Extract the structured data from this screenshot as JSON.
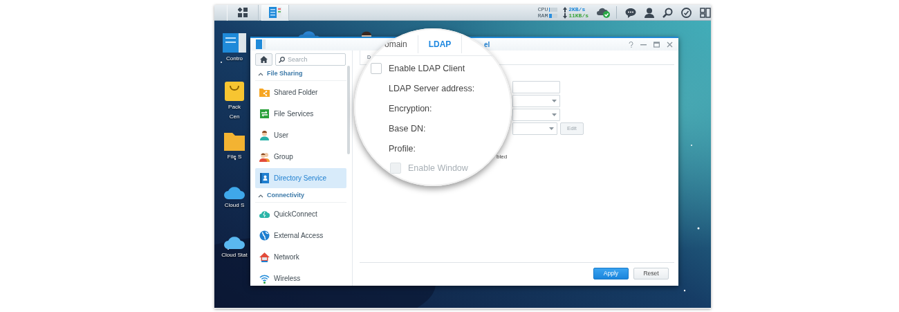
{
  "taskbar": {
    "apps": [
      {
        "kind": "main-menu",
        "selected": false
      },
      {
        "kind": "control-panel",
        "selected": true
      }
    ],
    "meters": [
      {
        "label": "CPU",
        "level": 0.1
      },
      {
        "label": "RAM",
        "level": 0.3
      }
    ],
    "upload": "2KB/s",
    "download": "11KB/s"
  },
  "desktop_icons": [
    {
      "lines": [
        "Contro"
      ]
    },
    {
      "lines": [
        "Pack",
        "Cen"
      ]
    },
    {
      "lines": [
        "File S"
      ]
    },
    {
      "lines": [
        "Cloud S"
      ]
    },
    {
      "lines": [
        "Cloud Stat"
      ]
    }
  ],
  "window": {
    "tab_fragment": "el",
    "sidebar": {
      "search": {
        "placeholder": "Search"
      },
      "sections": [
        {
          "title": "File Sharing",
          "expanded": true,
          "items": [
            {
              "label": "Shared Folder",
              "selected": false
            },
            {
              "label": "File Services",
              "selected": false
            },
            {
              "label": "User",
              "selected": false
            },
            {
              "label": "Group",
              "selected": false
            },
            {
              "label": "Directory Service",
              "selected": true
            }
          ]
        },
        {
          "title": "Connectivity",
          "expanded": true,
          "items": [
            {
              "label": "QuickConnect",
              "selected": false
            },
            {
              "label": "External Access",
              "selected": false
            },
            {
              "label": "Network",
              "selected": false
            },
            {
              "label": "Wireless",
              "selected": false
            }
          ]
        }
      ]
    },
    "pane_hint": "D",
    "fields": [
      {
        "kind": "text"
      },
      {
        "kind": "select"
      },
      {
        "kind": "select"
      },
      {
        "kind": "select",
        "button": {
          "label": "Edit",
          "disabled": true
        }
      }
    ],
    "status_fragment": "bled",
    "buttons": [
      {
        "label": "Apply",
        "kind": "primary"
      },
      {
        "label": "Reset",
        "kind": "secondary"
      }
    ]
  },
  "magnifier": {
    "tabs": [
      {
        "label": "omain",
        "selected": false
      },
      {
        "label": "LDAP",
        "selected": true
      }
    ],
    "enable_ldap": {
      "label": "Enable LDAP Client",
      "checked": false,
      "disabled": false
    },
    "labels": [
      "LDAP Server address:",
      "Encryption:",
      "Base DN:",
      "Profile:"
    ],
    "enable_windows": {
      "label": "Enable Window",
      "checked": false,
      "disabled": true
    }
  }
}
